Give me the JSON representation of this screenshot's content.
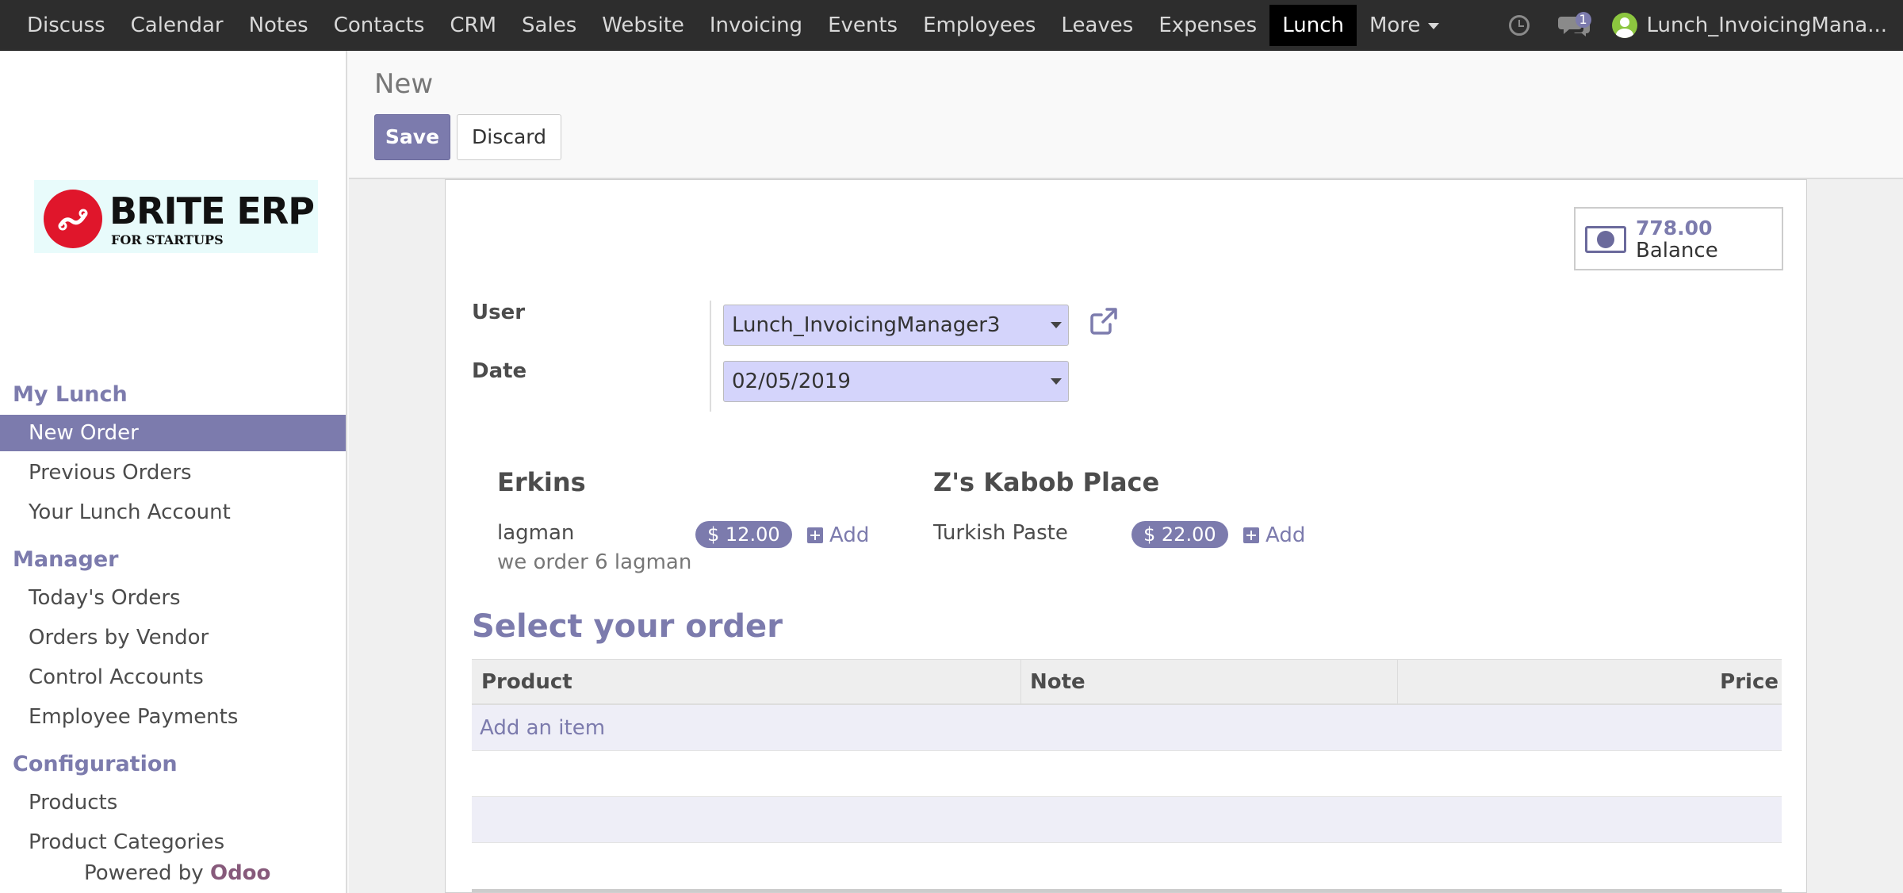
{
  "topbar": {
    "menu": [
      "Discuss",
      "Calendar",
      "Notes",
      "Contacts",
      "CRM",
      "Sales",
      "Website",
      "Invoicing",
      "Events",
      "Employees",
      "Leaves",
      "Expenses",
      "Lunch",
      "More"
    ],
    "active": "Lunch",
    "chat_count": "1",
    "username": "Lunch_InvoicingMana..."
  },
  "logo": {
    "title": "BRITE ERP",
    "subtitle": "FOR STARTUPS"
  },
  "sidebar": {
    "sections": [
      {
        "title": "My Lunch",
        "items": [
          "New Order",
          "Previous Orders",
          "Your Lunch Account"
        ]
      },
      {
        "title": "Manager",
        "items": [
          "Today's Orders",
          "Orders by Vendor",
          "Control Accounts",
          "Employee Payments"
        ]
      },
      {
        "title": "Configuration",
        "items": [
          "Products",
          "Product Categories"
        ]
      }
    ],
    "active_item": "New Order",
    "powered_by": "Powered by",
    "powered_brand": "Odoo"
  },
  "control": {
    "breadcrumb": "New",
    "save_label": "Save",
    "discard_label": "Discard"
  },
  "form": {
    "balance_value": "778.00",
    "balance_label": "Balance",
    "user_label": "User",
    "user_value": "Lunch_InvoicingManager3",
    "date_label": "Date",
    "date_value": "02/05/2019",
    "vendors": [
      {
        "name": "Erkins",
        "product": "lagman",
        "price": "$ 12.00",
        "note": "we order 6 lagman",
        "add": "Add"
      },
      {
        "name": "Z's Kabob Place",
        "product": "Turkish Paste",
        "price": "$ 22.00",
        "note": "",
        "add": "Add"
      }
    ],
    "order_title": "Select your order",
    "columns": [
      "Product",
      "Note",
      "Price"
    ],
    "add_item": "Add an item"
  },
  "colors": {
    "accent": "#7c7bad",
    "topbar": "#2d2d2d",
    "field_bg": "#d4d4fb"
  }
}
